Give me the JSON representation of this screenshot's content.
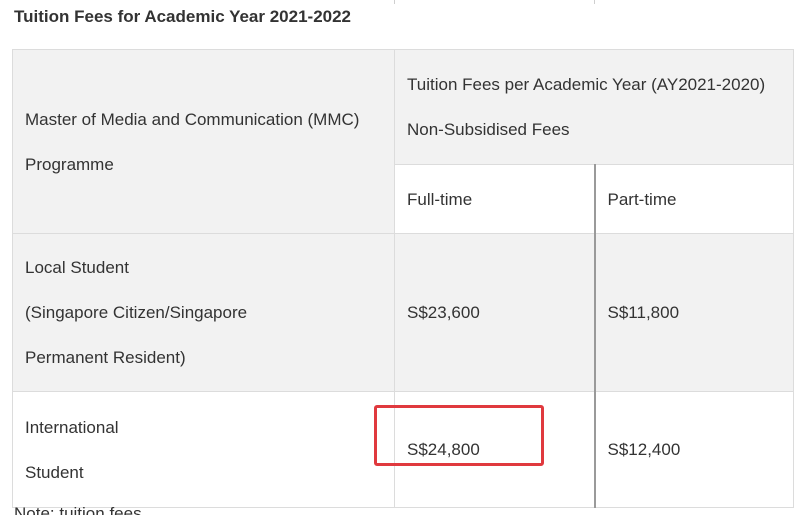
{
  "page": {
    "title": "Tuition Fees for Academic Year 2021-2022",
    "note": "Note: tuition fees"
  },
  "table": {
    "corner_header": [
      "Master of Media and Communication (MMC)",
      "Programme"
    ],
    "group_header": [
      "Tuition Fees per Academic Year (AY2021-2020)",
      "Non-Subsidised Fees"
    ],
    "columns": [
      "Full-time",
      "Part-time"
    ],
    "rows": [
      {
        "label": [
          "Local Student",
          "(Singapore Citizen/Singapore",
          "Permanent Resident)"
        ],
        "full_time": "S$23,600",
        "part_time": "S$11,800"
      },
      {
        "label": [
          "International",
          "Student"
        ],
        "full_time": "S$24,800",
        "part_time": "S$12,400"
      }
    ]
  },
  "colors": {
    "header_background": "#f2f2f2",
    "highlight": "#e0393e",
    "border": "#dcdcdc"
  }
}
